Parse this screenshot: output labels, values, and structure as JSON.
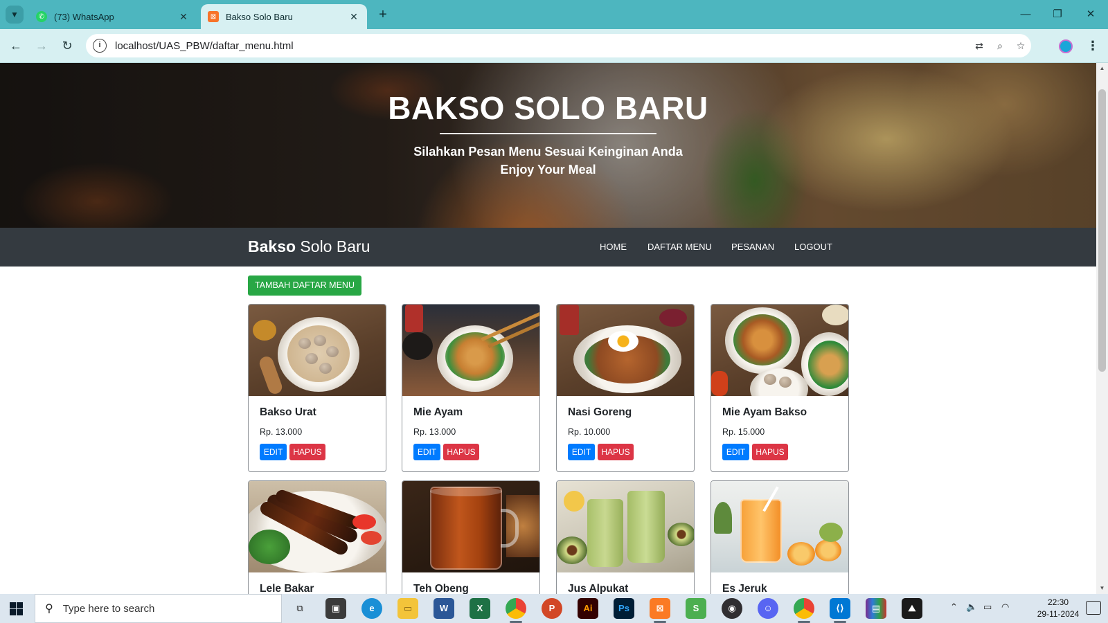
{
  "browser": {
    "tab_search_icon": "chevron-down-icon",
    "tabs": [
      {
        "title": "(73) WhatsApp",
        "favicon": "whatsapp-icon",
        "active": false
      },
      {
        "title": "Bakso Solo Baru",
        "favicon": "xampp-icon",
        "active": true
      }
    ],
    "new_tab_symbol": "+",
    "address": "localhost/UAS_PBW/daftar_menu.html"
  },
  "page": {
    "hero": {
      "title": "BAKSO SOLO BARU",
      "subtitle_line1": "Silahkan Pesan Menu Sesuai Keinginan Anda",
      "subtitle_line2": "Enjoy Your Meal"
    },
    "navbar": {
      "brand_bold": "Bakso",
      "brand_rest": " Solo Baru",
      "links": [
        "HOME",
        "DAFTAR MENU",
        "PESANAN",
        "LOGOUT"
      ]
    },
    "add_button": "TAMBAH DAFTAR MENU",
    "edit_label": "EDIT",
    "delete_label": "HAPUS",
    "menu_items": [
      {
        "name": "Bakso Urat",
        "price": "Rp. 13.000"
      },
      {
        "name": "Mie Ayam",
        "price": "Rp. 13.000"
      },
      {
        "name": "Nasi Goreng",
        "price": "Rp. 10.000"
      },
      {
        "name": "Mie Ayam Bakso",
        "price": "Rp. 15.000"
      },
      {
        "name": "Lele Bakar",
        "price": ""
      },
      {
        "name": "Teh Obeng",
        "price": ""
      },
      {
        "name": "Jus Alpukat",
        "price": ""
      },
      {
        "name": "Es Jeruk",
        "price": ""
      }
    ],
    "colors": {
      "navbar": "#343a40",
      "add_button": "#28a745",
      "edit_button": "#007bff",
      "delete_button": "#dc3545"
    }
  },
  "taskbar": {
    "search_placeholder": "Type here to search",
    "time": "22:30",
    "date": "29-11-2024",
    "apps": [
      "task-view-icon",
      "store-icon",
      "edge-icon",
      "file-explorer-icon",
      "word-icon",
      "excel-icon",
      "chrome-icon",
      "powerpoint-icon",
      "illustrator-icon",
      "photoshop-icon",
      "xampp-icon",
      "sublime-icon",
      "obs-icon",
      "discord-icon",
      "chrome-profile-icon",
      "vscode-icon",
      "winrar-icon",
      "photos-icon"
    ]
  }
}
